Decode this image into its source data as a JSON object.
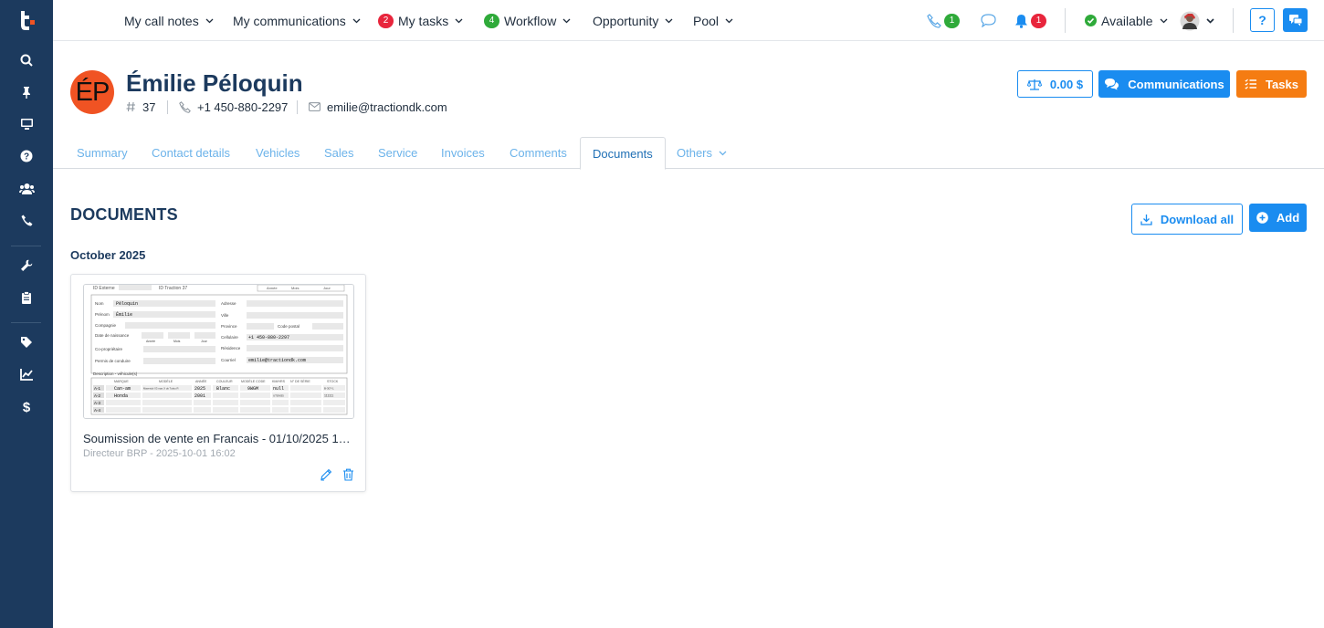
{
  "app": {
    "logo_icon": "traction-logo-icon",
    "sidebar_icons": [
      "search-icon",
      "pin-icon",
      "monitor-icon",
      "help-circle-icon",
      "users-icon",
      "phone-icon",
      "wrench-icon",
      "clipboard-icon",
      "tag-icon",
      "chart-line-icon",
      "dollar-icon"
    ]
  },
  "topnav": {
    "call_notes": "My call notes",
    "communications": "My communications",
    "tasks": "My tasks",
    "tasks_badge": "2",
    "workflow": "Workflow",
    "workflow_badge": "4",
    "opportunity": "Opportunity",
    "pool": "Pool",
    "phone_badge": "1",
    "bell_badge": "1",
    "status": "Available",
    "help": "?"
  },
  "contact": {
    "initials": "ÉP",
    "name": "Émilie Péloquin",
    "id": "37",
    "phone": "+1 450-880-2297",
    "email": "emilie@tractiondk.com",
    "balance": "0.00 $",
    "communications_btn": "Communications",
    "tasks_btn": "Tasks"
  },
  "tabs": [
    "Summary",
    "Contact details",
    "Vehicles",
    "Sales",
    "Service",
    "Invoices",
    "Comments",
    "Documents",
    "Others"
  ],
  "active_tab": "Documents",
  "documents": {
    "title": "DOCUMENTS",
    "download_all": "Download all",
    "add": "Add",
    "groups": [
      {
        "label": "October 2025",
        "items": [
          {
            "name": "Soumission de vente en Francais - 01/10/2025 16...",
            "subtitle": "Directeur BRP - 2025-10-01 16:02",
            "thumb": {
              "nom": "Péloquin",
              "prenom": "Émilie",
              "cellulaire": "+1 450-880-2297",
              "courriel": "emilie@tractiondk.com",
              "rows": [
                {
                  "id": "A-1",
                  "marque": "Can-am",
                  "annee": "2025",
                  "couleur": "Blanc",
                  "code": "9WGM",
                  "serie": "null"
                },
                {
                  "id": "A-2",
                  "marque": "Honda",
                  "annee": "2001",
                  "couleur": "",
                  "code": "",
                  "serie": ""
                },
                {
                  "id": "A-3",
                  "marque": "",
                  "annee": "",
                  "couleur": "",
                  "code": "",
                  "serie": ""
                },
                {
                  "id": "A-4",
                  "marque": "",
                  "annee": "",
                  "couleur": "",
                  "code": "",
                  "serie": ""
                }
              ]
            }
          }
        ]
      }
    ]
  },
  "colors": {
    "sidebar": "#1c3a5e",
    "accent_blue": "#1a8cf0",
    "orange": "#f57c12",
    "avatar": "#f05323",
    "badge_red": "#e8253c",
    "badge_green": "#2faa3a"
  }
}
